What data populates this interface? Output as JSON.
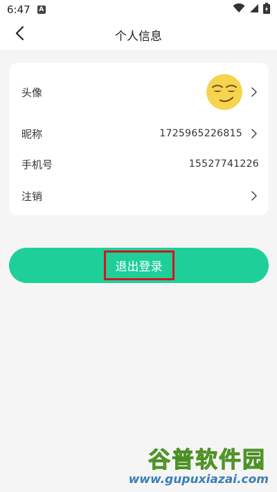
{
  "status_bar": {
    "time": "6:47",
    "notification_badge": "A"
  },
  "nav": {
    "title": "个人信息"
  },
  "profile": {
    "rows": [
      {
        "label": "头像"
      },
      {
        "label": "昵称",
        "value": "1725965226815"
      },
      {
        "label": "手机号",
        "value": "15527741226"
      },
      {
        "label": "注销"
      }
    ]
  },
  "actions": {
    "logout_label": "退出登录"
  },
  "watermark": {
    "cn": "谷普软件园",
    "url": "www.gupuxiazai.com"
  },
  "colors": {
    "accent": "#1ecf9a",
    "highlight_border": "#d6141c",
    "avatar": "#f7d44f"
  }
}
